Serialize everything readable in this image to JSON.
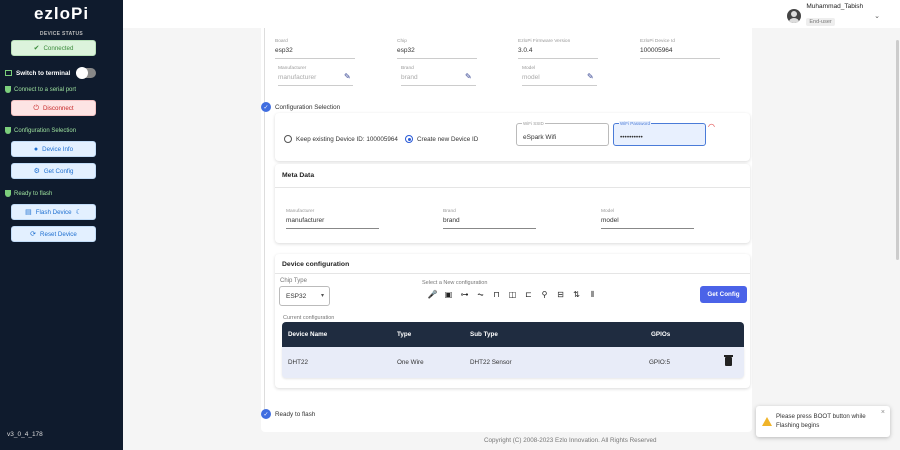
{
  "sidebar": {
    "logo": "ezloPi",
    "device_status_label": "DEVICE STATUS",
    "connected_label": "Connected",
    "switch_terminal_label": "Switch to terminal",
    "connect_serial_label": "Connect to a serial port",
    "disconnect_label": "Disconnect",
    "config_selection_label": "Configuration Selection",
    "device_info_label": "Device Info",
    "get_config_label": "Get Config",
    "ready_flash_label": "Ready to flash",
    "flash_device_label": "Flash Device",
    "reset_device_label": "Reset Device",
    "version": "v3_0_4_178"
  },
  "user": {
    "name": "Muhammad_Tabish",
    "role": "End-user"
  },
  "device_info": {
    "board_label": "Board",
    "board_value": "esp32",
    "chip_label": "Chip",
    "chip_value": "esp32",
    "firmware_label": "EzloPi Firmware Version",
    "firmware_value": "3.0.4",
    "device_id_label": "EzloPi Device Id",
    "device_id_value": "100005964",
    "manufacturer_label": "Manufacturer",
    "manufacturer_value": "manufacturer",
    "brand_label": "Brand",
    "brand_value": "brand",
    "model_label": "Model",
    "model_value": "model"
  },
  "config_selection": {
    "step_label": "Configuration Selection",
    "keep_existing_label": "Keep existing Device ID: 100005964",
    "create_new_label": "Create new Device ID",
    "wifi_ssid_label": "WiFi SSID",
    "wifi_ssid_value": "eSpark Wifi",
    "wifi_password_label": "WiFi Password",
    "wifi_password_value": "••••••••••"
  },
  "meta_data": {
    "title": "Meta Data",
    "manufacturer_label": "Manufacturer",
    "manufacturer_value": "manufacturer",
    "brand_label": "Brand",
    "brand_value": "brand",
    "model_label": "Model",
    "model_value": "model"
  },
  "device_config": {
    "title": "Device configuration",
    "chip_type_label": "Chip Type",
    "chip_type_value": "ESP32",
    "select_new_label": "Select a New configuration",
    "get_config_label": "Get Config",
    "current_config_label": "Current configuration",
    "table": {
      "headers": [
        "Device Name",
        "Type",
        "Sub Type",
        "GPIOs"
      ],
      "rows": [
        [
          "DHT22",
          "One Wire",
          "DHT22 Sensor",
          "GPIO:5"
        ]
      ]
    }
  },
  "ready_to_flash_label": "Ready to flash",
  "footer": "Copyright (C) 2008-2023 Ezlo Innovation. All Rights Reserved",
  "toast": {
    "message": "Please press BOOT button while Flashing begins"
  }
}
